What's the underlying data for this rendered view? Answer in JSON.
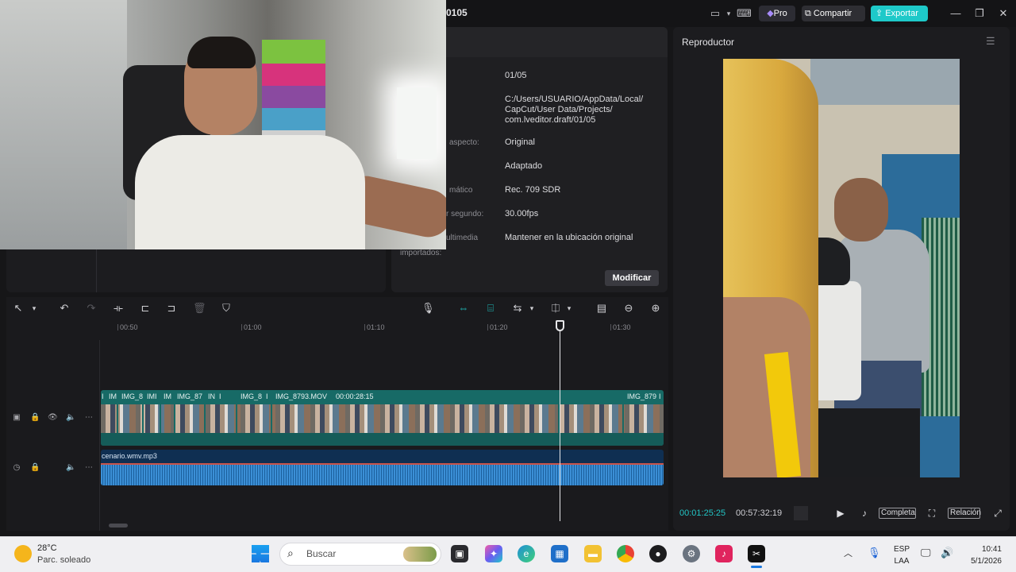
{
  "window": {
    "project_title": "0105",
    "pro_label": "Pro",
    "share_label": "Compartir",
    "export_label": "Exportar"
  },
  "project_info": {
    "rows": [
      {
        "label": "",
        "value": "01/05"
      },
      {
        "label": "",
        "value": "C:/Users/USUARIO/AppData/Local/ CapCut/User Data/Projects/ com.lveditor.draft/01/05"
      },
      {
        "label": "aspecto:",
        "value": "Original"
      },
      {
        "label": "",
        "value": "Adaptado"
      },
      {
        "label": "mático",
        "value": "Rec. 709 SDR"
      },
      {
        "label": "r segundo:",
        "value": "30.00fps"
      },
      {
        "label": "ultimedia",
        "value": "Mantener en la ubicación original"
      }
    ],
    "imported_label": "importados:",
    "modify_label": "Modificar"
  },
  "player": {
    "title": "Reproductor",
    "current_time": "00:01:25:25",
    "total_time": "00:57:32:19",
    "full_label": "Completa",
    "ratio_label": "Relación"
  },
  "timeline": {
    "ruler": [
      "00:50",
      "01:00",
      "01:10",
      "01:20",
      "01:30"
    ],
    "video_clips": [
      "I",
      "IM",
      "IMG_8",
      "IMI",
      "IM",
      "IMG_87",
      "IN",
      "I",
      "IMG_8",
      "I",
      "IMG_8793.MOV",
      "00:00:28:15",
      "IMG_879",
      "I"
    ],
    "audio_clip": "cenario.wmv.mp3"
  },
  "taskbar": {
    "temperature": "28°C",
    "weather": "Parc. soleado",
    "search_placeholder": "Buscar",
    "lang_top": "ESP",
    "lang_bottom": "LAA",
    "time": "10:41",
    "date": "5/1/2026"
  },
  "colors": {
    "accent": "#1ec9c9",
    "video_track": "#176a66",
    "audio_track": "#0f2f52"
  }
}
